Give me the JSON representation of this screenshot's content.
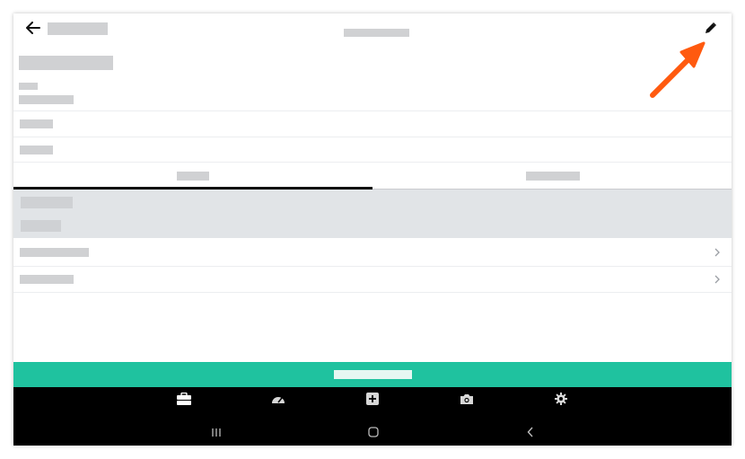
{
  "colors": {
    "accent_green": "#1fc29f",
    "annotation_orange": "#ff5a0f",
    "placeholder_grey": "#d0d1d3",
    "panel_grey": "#e1e4e7",
    "nav_black": "#000000"
  },
  "header": {
    "back_icon": "arrow-left-icon",
    "edit_icon": "pencil-icon",
    "title": "",
    "subtitle": ""
  },
  "tabs": [
    {
      "label": "",
      "active": true
    },
    {
      "label": "",
      "active": false
    }
  ],
  "list_rows": [
    {
      "chevron_icon": "chevron-right-icon"
    },
    {
      "chevron_icon": "chevron-right-icon"
    }
  ],
  "bottom_nav": {
    "items": [
      {
        "icon": "briefcase-icon"
      },
      {
        "icon": "speedometer-icon"
      },
      {
        "icon": "plus-square-icon"
      },
      {
        "icon": "camera-icon"
      },
      {
        "icon": "gear-icon"
      }
    ],
    "system_buttons": [
      {
        "icon": "recent-apps-icon"
      },
      {
        "icon": "home-icon"
      },
      {
        "icon": "back-chevron-icon"
      }
    ]
  },
  "annotation": {
    "icon": "arrow-pointer-icon",
    "points_to": "edit-button"
  }
}
